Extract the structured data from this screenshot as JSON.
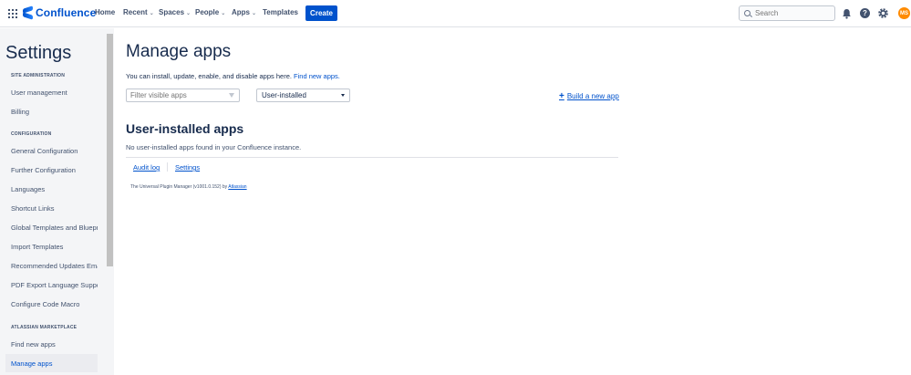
{
  "topnav": {
    "logo_text": "Confluence",
    "items": [
      {
        "label": "Home"
      },
      {
        "label": "Recent"
      },
      {
        "label": "Spaces"
      },
      {
        "label": "People"
      },
      {
        "label": "Apps"
      },
      {
        "label": "Templates"
      }
    ],
    "create_label": "Create",
    "search_placeholder": "Search",
    "avatar_initials": "MS"
  },
  "sidebar": {
    "title": "Settings",
    "sections": [
      {
        "heading": "SITE ADMINISTRATION",
        "items": [
          "User management",
          "Billing"
        ]
      },
      {
        "heading": "CONFIGURATION",
        "items": [
          "General Configuration",
          "Further Configuration",
          "Languages",
          "Shortcut Links",
          "Global Templates and Blueprints",
          "Import Templates",
          "Recommended Updates Email",
          "PDF Export Language Support",
          "Configure Code Macro"
        ]
      },
      {
        "heading": "ATLASSIAN MARKETPLACE",
        "items": [
          "Find new apps",
          "Manage apps"
        ]
      }
    ]
  },
  "main": {
    "title": "Manage apps",
    "intro_text": "You can install, update, enable, and disable apps here. ",
    "intro_link": "Find new apps.",
    "filter_placeholder": "Filter visible apps",
    "select_value": "User-installed",
    "build_link": "Build a new app",
    "section_title": "User-installed apps",
    "empty_message": "No user-installed apps found in your Confluence instance.",
    "audit_log": "Audit log",
    "settings_link": "Settings",
    "upm_text": "The Universal Plugin Manager (v1001.0.152) by ",
    "upm_by": "Atlassian"
  },
  "colors": {
    "brand": "#0052cc",
    "avatar": "#ff8b00"
  }
}
